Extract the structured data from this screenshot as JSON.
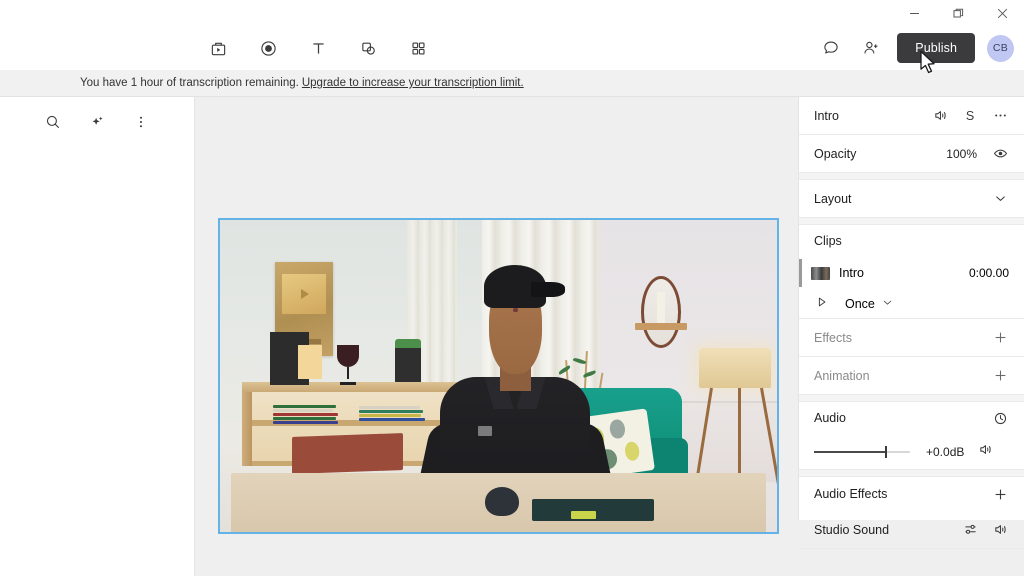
{
  "window": {
    "controls": [
      {
        "name": "minimize",
        "glyph": "minimize-icon"
      },
      {
        "name": "restore",
        "glyph": "restore-icon"
      },
      {
        "name": "close",
        "glyph": "close-icon"
      }
    ]
  },
  "toolbar": {
    "tools": [
      {
        "name": "media-icon",
        "label": "Media"
      },
      {
        "name": "record-icon",
        "label": "Record"
      },
      {
        "name": "text-icon",
        "label": "Text"
      },
      {
        "name": "shapes-icon",
        "label": "Shapes"
      },
      {
        "name": "apps-grid-icon",
        "label": "More"
      }
    ],
    "comment_label": "Comments",
    "invite_label": "Invite",
    "publish_label": "Publish",
    "avatar_initials": "CB",
    "avatar_color": "#bfc7f2",
    "publish_color": "#3b3b3d"
  },
  "banner": {
    "message": "You have 1 hour of transcription remaining.",
    "link": "Upgrade to increase your transcription limit."
  },
  "left_panel": {
    "tools": [
      {
        "name": "search-icon",
        "label": "Search"
      },
      {
        "name": "sparkle-icon",
        "label": "AI"
      },
      {
        "name": "more-vertical-icon",
        "label": "More options"
      }
    ]
  },
  "stage": {
    "selection_color": "#63b3e8"
  },
  "inspector": {
    "header": {
      "title": "Intro",
      "mute_icon": "speaker-icon",
      "solo_label": "S",
      "more_icon": "more-horizontal-icon"
    },
    "opacity": {
      "label": "Opacity",
      "value": "100%",
      "visibility_icon": "eye-icon"
    },
    "layout": {
      "label": "Layout",
      "chevron_icon": "chevron-down-icon"
    },
    "clips": {
      "label": "Clips",
      "items": [
        {
          "name": "Intro",
          "time": "0:00.00"
        }
      ],
      "playback_label": "Once",
      "play_icon": "play-icon",
      "chevron_icon": "chevron-down-icon"
    },
    "effects": {
      "label": "Effects",
      "add_icon": "plus-icon"
    },
    "animation": {
      "label": "Animation",
      "add_icon": "plus-icon"
    },
    "audio": {
      "label": "Audio",
      "reset_icon": "clock-icon",
      "gain": "+0.0dB",
      "volume_icon": "speaker-icon",
      "slider_percent": 74
    },
    "audio_effects": {
      "label": "Audio Effects",
      "add_icon": "plus-icon",
      "items": [
        {
          "label": "Studio Sound",
          "settings_icon": "sliders-icon",
          "toggle_icon": "speaker-icon"
        }
      ]
    }
  }
}
